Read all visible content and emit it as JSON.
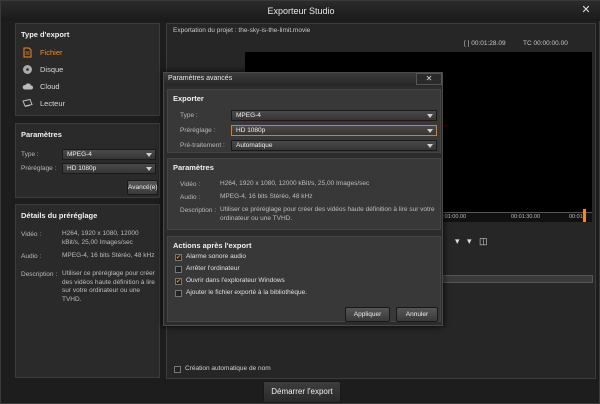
{
  "window": {
    "title": "Exporteur Studio"
  },
  "export_type": {
    "header": "Type d'export",
    "items": [
      {
        "label": "Fichier",
        "selected": true
      },
      {
        "label": "Disque",
        "selected": false
      },
      {
        "label": "Cloud",
        "selected": false
      },
      {
        "label": "Lecteur",
        "selected": false
      }
    ]
  },
  "params": {
    "header": "Paramètres",
    "type_label": "Type :",
    "type_value": "MPEG-4",
    "preset_label": "Préréglage :",
    "preset_value": "HD 1080p",
    "advanced_button": "Avancé(e)"
  },
  "preset_details": {
    "header": "Détails du préréglage",
    "video_label": "Vidéo :",
    "video_value": "H264, 1920 x 1080, 12000 kBit/s, 25,00 Images/sec",
    "audio_label": "Audio :",
    "audio_value": "MPEG-4, 16 bits Stéréo, 48 kHz",
    "desc_label": "Description :",
    "desc_value": "Utiliser ce préréglage pour créer des vidéos haute définition à lire sur votre ordinateur ou une TVHD."
  },
  "project": {
    "label": "Exportation du projet : the-sky-is-the-limit.movie",
    "timecode_left": "[ ] 00:01:28.09",
    "timecode_right": "TC 00:00:00.00",
    "ruler_a": "00:01:00.00",
    "ruler_b": "00:01:30.00",
    "ruler_c": "00:01:"
  },
  "auto_name": {
    "label": "Création automatique de nom",
    "checked": false
  },
  "export_button": "Démarrer l'export",
  "advanced_dialog": {
    "title": "Paramètres avancés",
    "export_header": "Exporter",
    "type_label": "Type :",
    "type_value": "MPEG-4",
    "preset_label": "Préréglage :",
    "preset_value": "HD 1080p",
    "pre_label": "Pré-traitement :",
    "pre_value": "Automatique",
    "params_header": "Paramètres",
    "video_label": "Vidéo :",
    "video_value": "H264, 1920 x 1080, 12000 kBit/s, 25,00 Images/sec",
    "audio_label": "Audio :",
    "audio_value": "MPEG-4, 16 bits Stéréo, 48 kHz",
    "desc_label": "Description :",
    "desc_value": "Utiliser ce préréglage pour créer des vidéos haute définition à lire sur votre ordinateur ou une TVHD.",
    "actions_header": "Actions après l'export",
    "actions": [
      {
        "label": "Alarme sonore audio",
        "checked": true
      },
      {
        "label": "Arrêter l'ordinateur",
        "checked": false
      },
      {
        "label": "Ouvrir dans l'explorateur Windows",
        "checked": true
      },
      {
        "label": "Ajouter le fichier exporté à la bibliothèque.",
        "checked": false
      }
    ],
    "apply_button": "Appliquer",
    "cancel_button": "Annuler",
    "close_icon": "close-icon"
  },
  "accent_color": "#f08a24"
}
